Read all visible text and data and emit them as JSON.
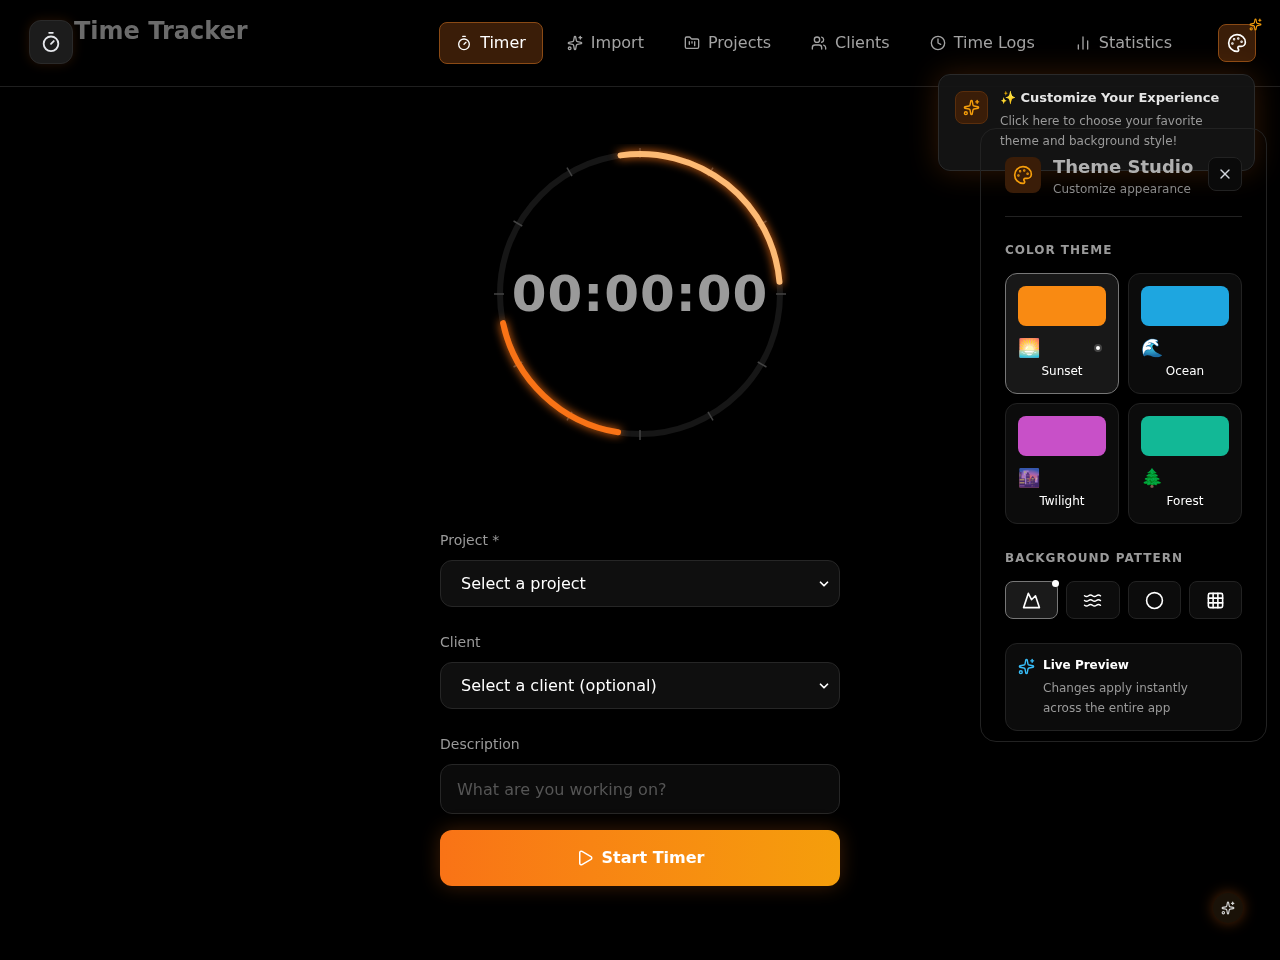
{
  "app": {
    "title": "Time Tracker"
  },
  "nav": [
    {
      "label": "Timer",
      "kind": "timer",
      "selected": true
    },
    {
      "label": "Import",
      "kind": "sparkles",
      "selected": false
    },
    {
      "label": "Projects",
      "kind": "folder",
      "selected": false
    },
    {
      "label": "Clients",
      "kind": "users",
      "selected": false
    },
    {
      "label": "Time Logs",
      "kind": "clock",
      "selected": false
    },
    {
      "label": "Statistics",
      "kind": "chart",
      "selected": false
    }
  ],
  "timer": {
    "display": "00:00:00"
  },
  "form": {
    "project": {
      "label": "Project *",
      "value": "Select a project"
    },
    "client": {
      "label": "Client",
      "value": "Select a client (optional)"
    },
    "description": {
      "label": "Description",
      "placeholder": "What are you working on?"
    },
    "start_button": "Start Timer"
  },
  "tooltip": {
    "title": "✨ Customize Your Experience",
    "text": "Click here to choose your favorite theme and background style!"
  },
  "theme_studio": {
    "title": "Theme Studio",
    "subtitle": "Customize appearance",
    "color_theme_heading": "COLOR THEME",
    "themes": [
      {
        "name": "Sunset",
        "emoji": "🌅",
        "color": "#f98a12",
        "selected": true
      },
      {
        "name": "Ocean",
        "emoji": "🌊",
        "color": "#1ea6e0",
        "selected": false
      },
      {
        "name": "Twilight",
        "emoji": "🌆",
        "color": "#c850c8",
        "selected": false
      },
      {
        "name": "Forest",
        "emoji": "🌲",
        "color": "#12b896",
        "selected": false
      }
    ],
    "pattern_heading": "BACKGROUND PATTERN",
    "patterns": [
      {
        "kind": "mountain",
        "selected": true
      },
      {
        "kind": "waves",
        "selected": false
      },
      {
        "kind": "circle",
        "selected": false
      },
      {
        "kind": "grid",
        "selected": false
      }
    ],
    "preview": {
      "title": "Live Preview",
      "text": "Changes apply instantly across the entire app"
    }
  }
}
